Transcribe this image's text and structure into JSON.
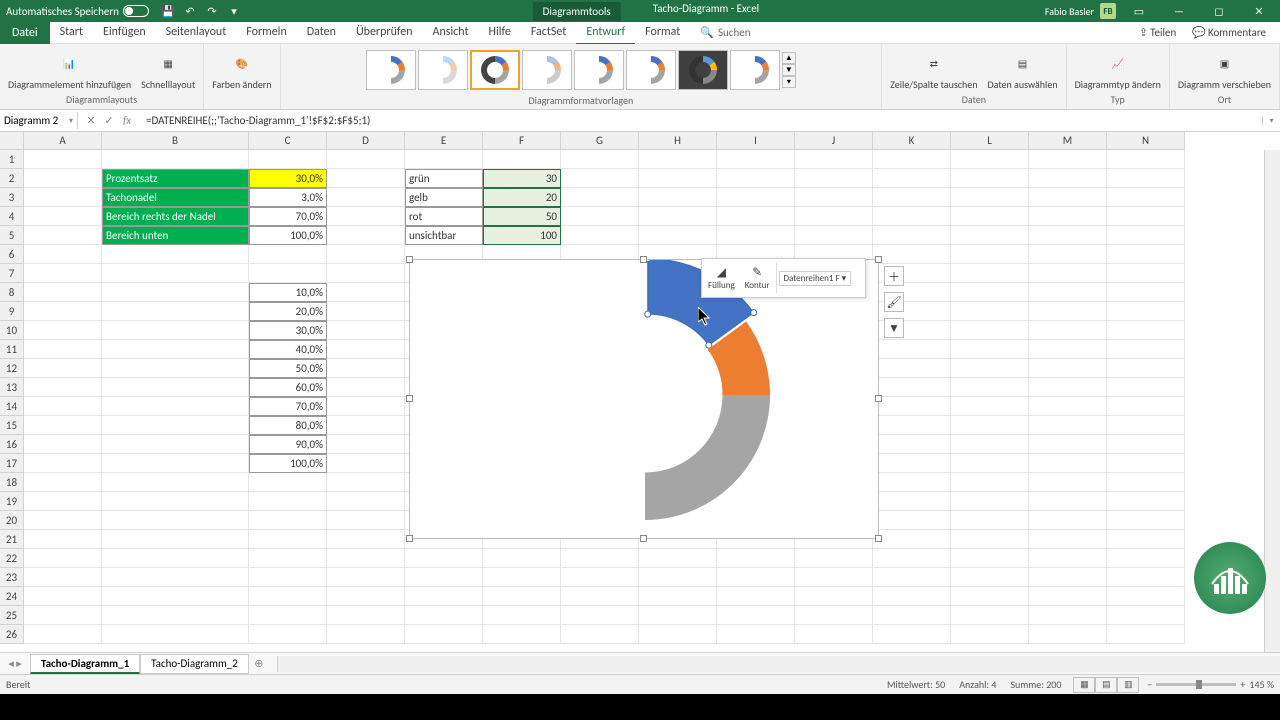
{
  "titlebar": {
    "autosave": "Automatisches Speichern",
    "tools_context": "Diagrammtools",
    "doc_title": "Tacho-Diagramm - Excel",
    "user": "Fabio Basler",
    "user_initials": "FB"
  },
  "menu": {
    "file": "Datei",
    "tabs": [
      "Start",
      "Einfügen",
      "Seitenlayout",
      "Formeln",
      "Daten",
      "Überprüfen",
      "Ansicht",
      "Hilfe",
      "FactSet",
      "Entwurf",
      "Format"
    ],
    "active": "Entwurf",
    "search": "Suchen",
    "share": "Teilen",
    "comments": "Kommentare"
  },
  "ribbon": {
    "group_layouts": "Diagrammlayouts",
    "btn_add_element": "Diagrammelement hinzufügen",
    "btn_quick_layout": "Schnelllayout",
    "btn_colors": "Farben ändern",
    "group_styles": "Diagrammformatvorlagen",
    "group_data": "Daten",
    "btn_switch": "Zeile/Spalte tauschen",
    "btn_select": "Daten auswählen",
    "group_type": "Typ",
    "btn_change_type": "Diagrammtyp ändern",
    "group_loc": "Ort",
    "btn_move": "Diagramm verschieben"
  },
  "formula": {
    "name": "Diagramm 2",
    "value": "=DATENREIHE(;;'Tacho-Diagramm_1'!$F$2:$F$5;1)"
  },
  "columns": [
    "A",
    "B",
    "C",
    "D",
    "E",
    "F",
    "G",
    "H",
    "I",
    "J",
    "K",
    "L",
    "M",
    "N"
  ],
  "table1": {
    "rows": [
      {
        "label": "Prozentsatz",
        "value": "30,0%",
        "yellow": true
      },
      {
        "label": "Tachonadel",
        "value": "3,0%"
      },
      {
        "label": "Bereich rechts der Nadel",
        "value": "70,0%"
      },
      {
        "label": "Bereich unten",
        "value": "100,0%"
      }
    ]
  },
  "table2": {
    "rows": [
      {
        "label": "grün",
        "value": "30"
      },
      {
        "label": "gelb",
        "value": "20"
      },
      {
        "label": "rot",
        "value": "50"
      },
      {
        "label": "unsichtbar",
        "value": "100"
      }
    ]
  },
  "list": [
    "10,0%",
    "20,0%",
    "30,0%",
    "40,0%",
    "50,0%",
    "60,0%",
    "70,0%",
    "80,0%",
    "90,0%",
    "100,0%"
  ],
  "minitool": {
    "fill": "Füllung",
    "outline": "Kontur",
    "combo": "Datenreihen1 F"
  },
  "sheets": {
    "active": "Tacho-Diagramm_1",
    "tabs": [
      "Tacho-Diagramm_1",
      "Tacho-Diagramm_2"
    ]
  },
  "status": {
    "ready": "Bereit",
    "avg_label": "Mittelwert:",
    "avg": "50",
    "count_label": "Anzahl:",
    "count": "4",
    "sum_label": "Summe:",
    "sum": "200",
    "zoom": "145 %"
  },
  "chart_data": {
    "type": "doughnut-half",
    "categories": [
      "grün",
      "gelb",
      "rot",
      "unsichtbar"
    ],
    "values": [
      30,
      20,
      50,
      100
    ],
    "colors": [
      "#4472c4",
      "#ed7d31",
      "#a5a5a5",
      "#ffffff"
    ],
    "rotation_start_deg": 270,
    "inner_radius_ratio": 0.62,
    "selected_segment": 0
  }
}
